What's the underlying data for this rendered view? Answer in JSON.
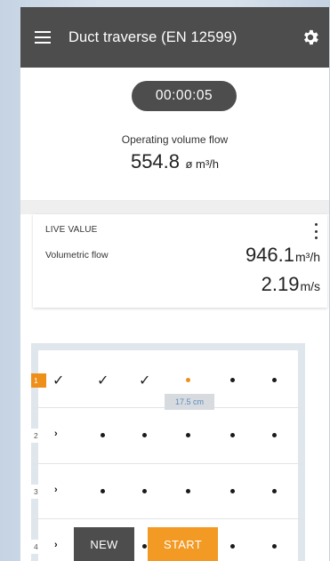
{
  "header": {
    "title": "Duct traverse (EN 12599)",
    "menu_icon": "hamburger-menu-icon",
    "settings_icon": "gear-icon",
    "color": "#4d4d4d"
  },
  "summary": {
    "timer": "00:00:05",
    "label": "Operating volume flow",
    "value": "554.8",
    "unit": "ø m³/h"
  },
  "live": {
    "title": "LIVE VALUE",
    "more_icon": "more-vertical-icon",
    "flow_label": "Volumetric flow",
    "flow_value": "946.1",
    "flow_unit": "m³/h",
    "speed_value": "2.19",
    "speed_unit": "m/s"
  },
  "grid": {
    "accent_color": "#ee8f1a",
    "rows": [
      {
        "label": "1",
        "state": "active",
        "points": [
          "done",
          "done",
          "done",
          "current",
          "pending",
          "pending"
        ]
      },
      {
        "label": "2",
        "state": "pending",
        "points": [
          "start",
          "pending",
          "pending",
          "pending",
          "pending",
          "pending"
        ]
      },
      {
        "label": "3",
        "state": "pending",
        "points": [
          "start",
          "pending",
          "pending",
          "pending",
          "pending",
          "pending"
        ]
      },
      {
        "label": "4",
        "state": "pending",
        "points": [
          "start",
          "pending",
          "pending",
          "pending",
          "pending",
          "pending"
        ]
      }
    ],
    "current_tag": "17.5 cm"
  },
  "buttons": {
    "new_label": "NEW",
    "start_label": "START"
  }
}
